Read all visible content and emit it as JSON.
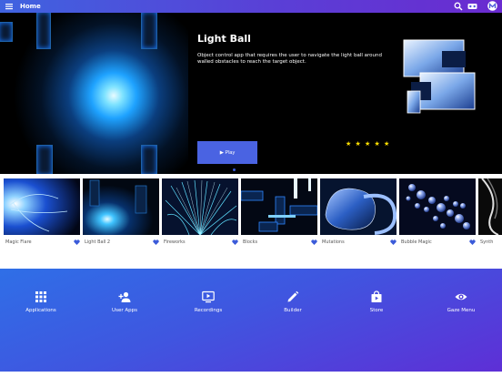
{
  "header": {
    "title": "Home",
    "icons": [
      "menu-icon",
      "search-icon",
      "vr-headset-icon",
      "account-icon"
    ]
  },
  "hero": {
    "title": "Light Ball",
    "description": "Object control app that requires the user to navigate the light ball around walled obstacles to reach the target object.",
    "play_label": "▶ Play",
    "rating": "★ ★ ★ ★ ★",
    "rating_value": 5,
    "accent": "#4a63e2"
  },
  "carousel": {
    "items": [
      {
        "label": "Magic Flare"
      },
      {
        "label": "Light Ball 2"
      },
      {
        "label": "Fireworks"
      },
      {
        "label": "Blocks"
      },
      {
        "label": "Mutations"
      },
      {
        "label": "Bubble Magic"
      },
      {
        "label": "Synth"
      }
    ]
  },
  "nav": {
    "items": [
      {
        "label": "Applications",
        "icon": "grid-icon"
      },
      {
        "label": "User Apps",
        "icon": "add-user-icon"
      },
      {
        "label": "Recordings",
        "icon": "play-screen-icon"
      },
      {
        "label": "Builder",
        "icon": "pencil-icon"
      },
      {
        "label": "Store",
        "icon": "store-bag-icon"
      },
      {
        "label": "Gaze Menu",
        "icon": "eye-icon"
      }
    ]
  },
  "colors": {
    "topbar": "#4b57dc",
    "heart": "#3b5bd9",
    "star": "#ffe000"
  }
}
